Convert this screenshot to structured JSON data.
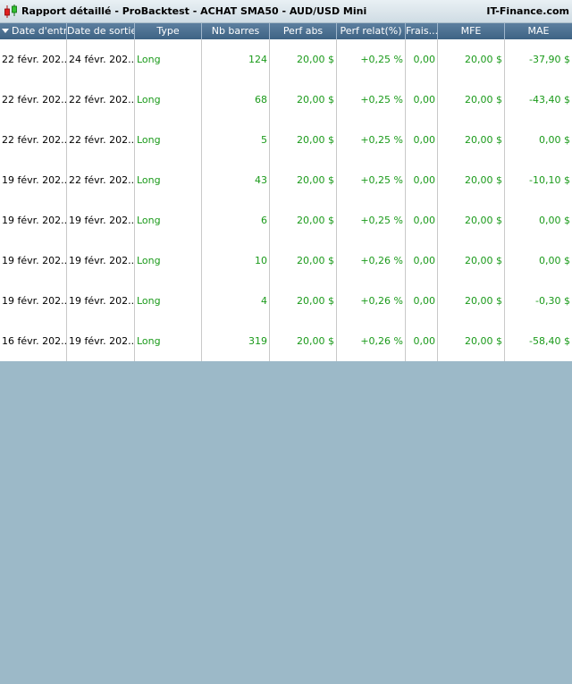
{
  "window": {
    "title": "Rapport détaillé - ProBacktest - ACHAT SMA50 - AUD/USD Mini",
    "brand": "IT-Finance.com",
    "icon": "candlestick-chart-icon"
  },
  "columns": [
    "Date d'entr...",
    "Date de sortie",
    "Type",
    "Nb barres",
    "Perf abs",
    "Perf relat(%)",
    "Frais...",
    "MFE",
    "MAE"
  ],
  "rows": [
    [
      "22 févr. 202...",
      "24 févr. 202...",
      "Long",
      "124",
      "20,00 $",
      "+0,25 %",
      "0,00",
      "20,00 $",
      "-37,90 $"
    ],
    [
      "22 févr. 202...",
      "22 févr. 202...",
      "Long",
      "68",
      "20,00 $",
      "+0,25 %",
      "0,00",
      "20,00 $",
      "-43,40 $"
    ],
    [
      "22 févr. 202...",
      "22 févr. 202...",
      "Long",
      "5",
      "20,00 $",
      "+0,25 %",
      "0,00",
      "20,00 $",
      "0,00 $"
    ],
    [
      "19 févr. 202...",
      "22 févr. 202...",
      "Long",
      "43",
      "20,00 $",
      "+0,25 %",
      "0,00",
      "20,00 $",
      "-10,10 $"
    ],
    [
      "19 févr. 202...",
      "19 févr. 202...",
      "Long",
      "6",
      "20,00 $",
      "+0,25 %",
      "0,00",
      "20,00 $",
      "0,00 $"
    ],
    [
      "19 févr. 202...",
      "19 févr. 202...",
      "Long",
      "10",
      "20,00 $",
      "+0,26 %",
      "0,00",
      "20,00 $",
      "0,00 $"
    ],
    [
      "19 févr. 202...",
      "19 févr. 202...",
      "Long",
      "4",
      "20,00 $",
      "+0,26 %",
      "0,00",
      "20,00 $",
      "-0,30 $"
    ],
    [
      "16 févr. 202...",
      "19 févr. 202...",
      "Long",
      "319",
      "20,00 $",
      "+0,26 %",
      "0,00",
      "20,00 $",
      "-58,40 $"
    ]
  ],
  "colors": {
    "header_bg": "#4a6e90",
    "value_green": "#1a9a1a",
    "background": "#9cb9c8"
  }
}
